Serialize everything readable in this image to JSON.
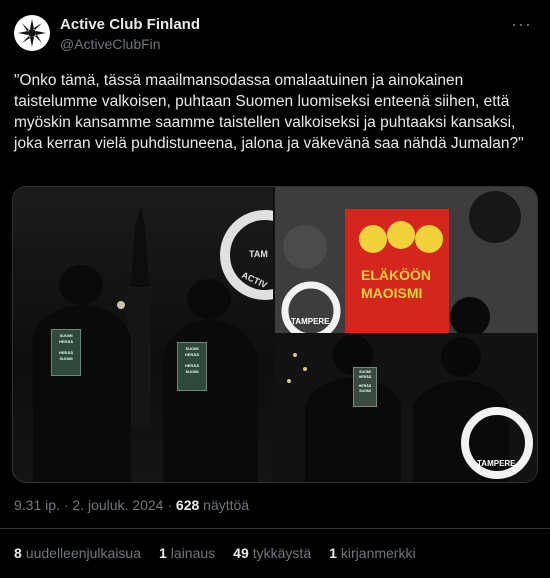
{
  "author": {
    "name": "Active Club Finland",
    "handle": "@ActiveClubFin",
    "avatar_icon": "sun-wheel-logo-icon"
  },
  "more_label": "···",
  "tweet": {
    "text": "\"Onko tämä, tässä maailmansodassa omalaatuinen ja ainokainen taistelumme valkoisen, puhtaan Suomen luomiseksi enteenä siihen, että myöskin kansamme saamme taistellen valkoiseksi ja puhtaaksi kansaksi, joka kerran vielä puhdistuneena, jalona ja väkevänä saa nähdä Jumalan?\""
  },
  "media": {
    "photo1": {
      "sign_lines": [
        "SUOMI",
        "HERÄÄ",
        "HERÄÄ",
        "SUOMI"
      ],
      "logo_text_top": "TAM",
      "logo_text_bottom": "ACTIV"
    },
    "photo2": {
      "poster_line1": "ELÄKÖÖN",
      "poster_line2": "MAOISMI",
      "logo_text": "TAMPERE"
    },
    "photo3": {
      "sign_lines": [
        "SUOMI",
        "HERÄÄ",
        "HERÄÄ",
        "SUOMI"
      ],
      "logo_text": "TAMPERE"
    }
  },
  "meta": {
    "time": "9.31 ip.",
    "sep1": "·",
    "date": "2. jouluk. 2024",
    "sep2": "·",
    "views_count": "628",
    "views_label": "näyttöä"
  },
  "stats": [
    {
      "count": "8",
      "label": "uudelleenjulkaisua"
    },
    {
      "count": "1",
      "label": "lainaus"
    },
    {
      "count": "49",
      "label": "tykkäystä"
    },
    {
      "count": "1",
      "label": "kirjanmerkki"
    }
  ],
  "colors": {
    "background": "#000000",
    "text": "#e7e9ea",
    "muted": "#71767b",
    "border": "#2f3336",
    "poster_red": "#d5261d",
    "poster_yellow": "#f2d23a"
  }
}
